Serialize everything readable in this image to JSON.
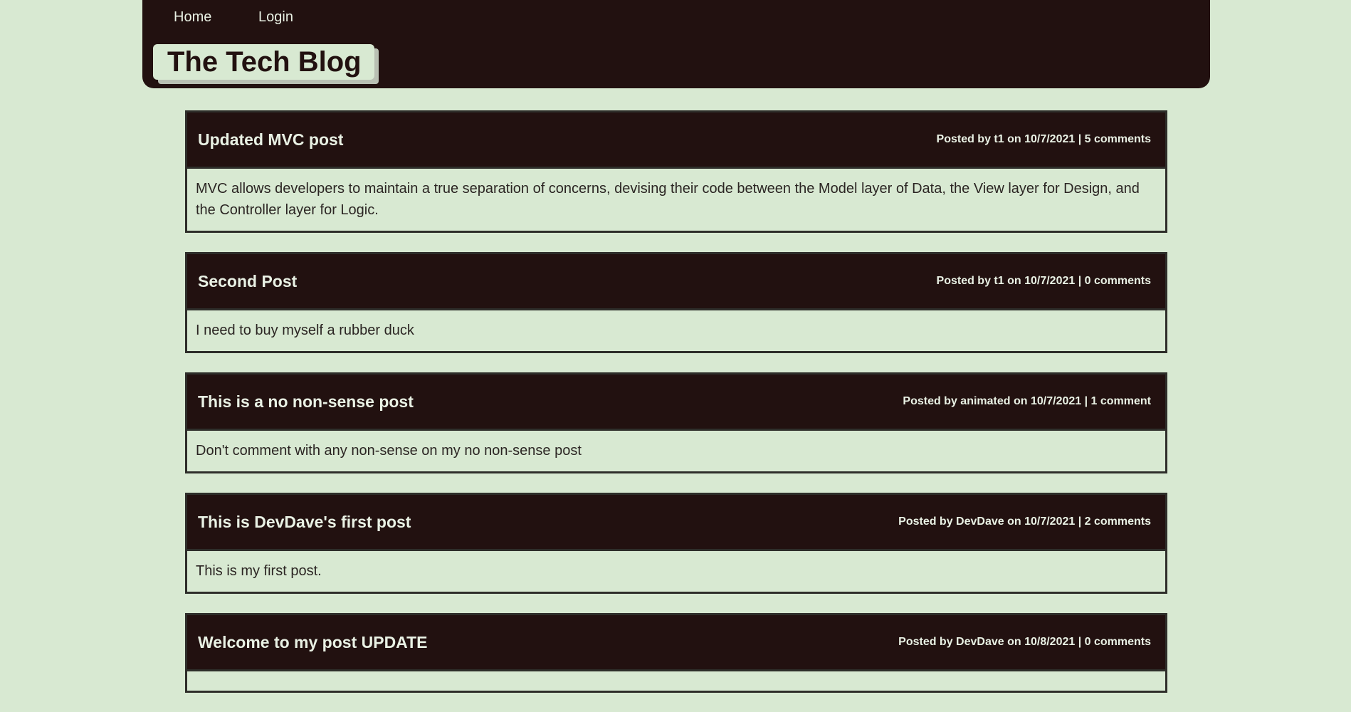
{
  "nav": {
    "home": "Home",
    "login": "Login"
  },
  "header": {
    "title": "The Tech Blog"
  },
  "posts": [
    {
      "title": "Updated MVC post",
      "meta": "Posted by t1 on 10/7/2021 | 5 comments",
      "body": "MVC allows developers to maintain a true separation of concerns, devising their code between the Model layer of Data, the View layer for Design, and the Controller layer for Logic."
    },
    {
      "title": "Second Post",
      "meta": "Posted by t1 on 10/7/2021 | 0 comments",
      "body": "I need to buy myself a rubber duck"
    },
    {
      "title": "This is a no non-sense post",
      "meta": "Posted by animated on 10/7/2021 | 1 comment",
      "body": "Don't comment with any non-sense on my no non-sense post"
    },
    {
      "title": "This is DevDave's first post",
      "meta": "Posted by DevDave on 10/7/2021 | 2 comments",
      "body": "This is my first post."
    },
    {
      "title": "Welcome to my post UPDATE",
      "meta": "Posted by DevDave on 10/8/2021 | 0 comments",
      "body": ""
    }
  ],
  "colors": {
    "background": "#d8e9d2",
    "header": "#221110",
    "header_text": "#e9f1e4",
    "border": "#2e2e2a"
  }
}
